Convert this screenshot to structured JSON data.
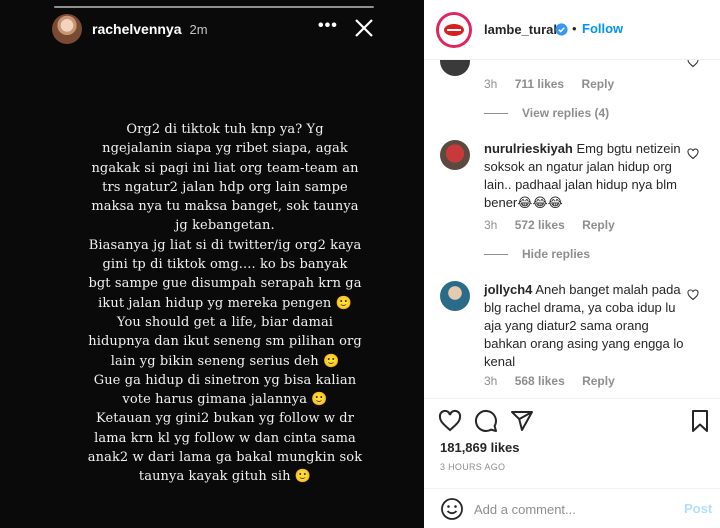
{
  "story": {
    "username": "rachelvennya",
    "time": "2m",
    "more": "•••",
    "text": "Org2 di tiktok tuh knp ya? Yg\nngejalanin siapa yg ribet siapa, agak\nngakak si pagi ini liat org team-team an\ntrs ngatur2 jalan hdp org lain sampe\nmaksa nya tu maksa banget, sok taunya\njg kebangetan.\nBiasanya jg liat si di twitter/ig org2 kaya\ngini tp di tiktok omg.... ko bs banyak\nbgt sampe gue disumpah serapah krn ga\nikut jalan hidup yg mereka pengen 🙂\nYou should get a life, biar damai\nhidupnya dan ikut seneng sm pilihan org\nlain yg bikin seneng serius deh 🙂\nGue ga hidup di sinetron yg bisa kalian\nvote harus gimana jalannya 🙂\nKetauan yg gini2 bukan yg follow w dr\nlama krn kl yg follow w dan cinta sama\nanak2 w dari lama ga bakal mungkin sok\ntaunya kayak gituh sih 🙂"
  },
  "post": {
    "username": "lambe_turah",
    "separator": "•",
    "follow_label": "Follow",
    "likes": "181,869 likes",
    "posted": "3 HOURS AGO"
  },
  "comments": {
    "first": {
      "time": "3h",
      "likes": "711 likes",
      "reply_label": "Reply",
      "view_replies": "View replies (4)"
    },
    "items": [
      {
        "username": "nurulrieskiyah",
        "text": "Emg bgtu netizein soksok an ngatur jalan hidup org lain.. padhaal jalan hidup nya blm bener😂😂😂",
        "time": "3h",
        "likes": "572 likes",
        "reply_label": "Reply",
        "replies_toggle": "Hide replies"
      },
      {
        "username": "jollych4",
        "text": "Aneh banget malah pada blg rachel drama, ya coba idup lu aja yang diatur2 sama orang bahkan orang asing yang engga lo kenal",
        "time": "3h",
        "likes": "568 likes",
        "reply_label": "Reply"
      }
    ]
  },
  "composer": {
    "placeholder": "Add a comment...",
    "post_label": "Post"
  },
  "colors": {
    "accent": "#0095f6",
    "post_disabled": "#b2dffc",
    "muted": "#8e8e8e",
    "story_bg": "#0a0a0a"
  },
  "icons": [
    "close-icon",
    "more-icon",
    "verified-icon",
    "heart-icon",
    "comment-icon",
    "share-icon",
    "bookmark-icon",
    "emoji-icon"
  ]
}
